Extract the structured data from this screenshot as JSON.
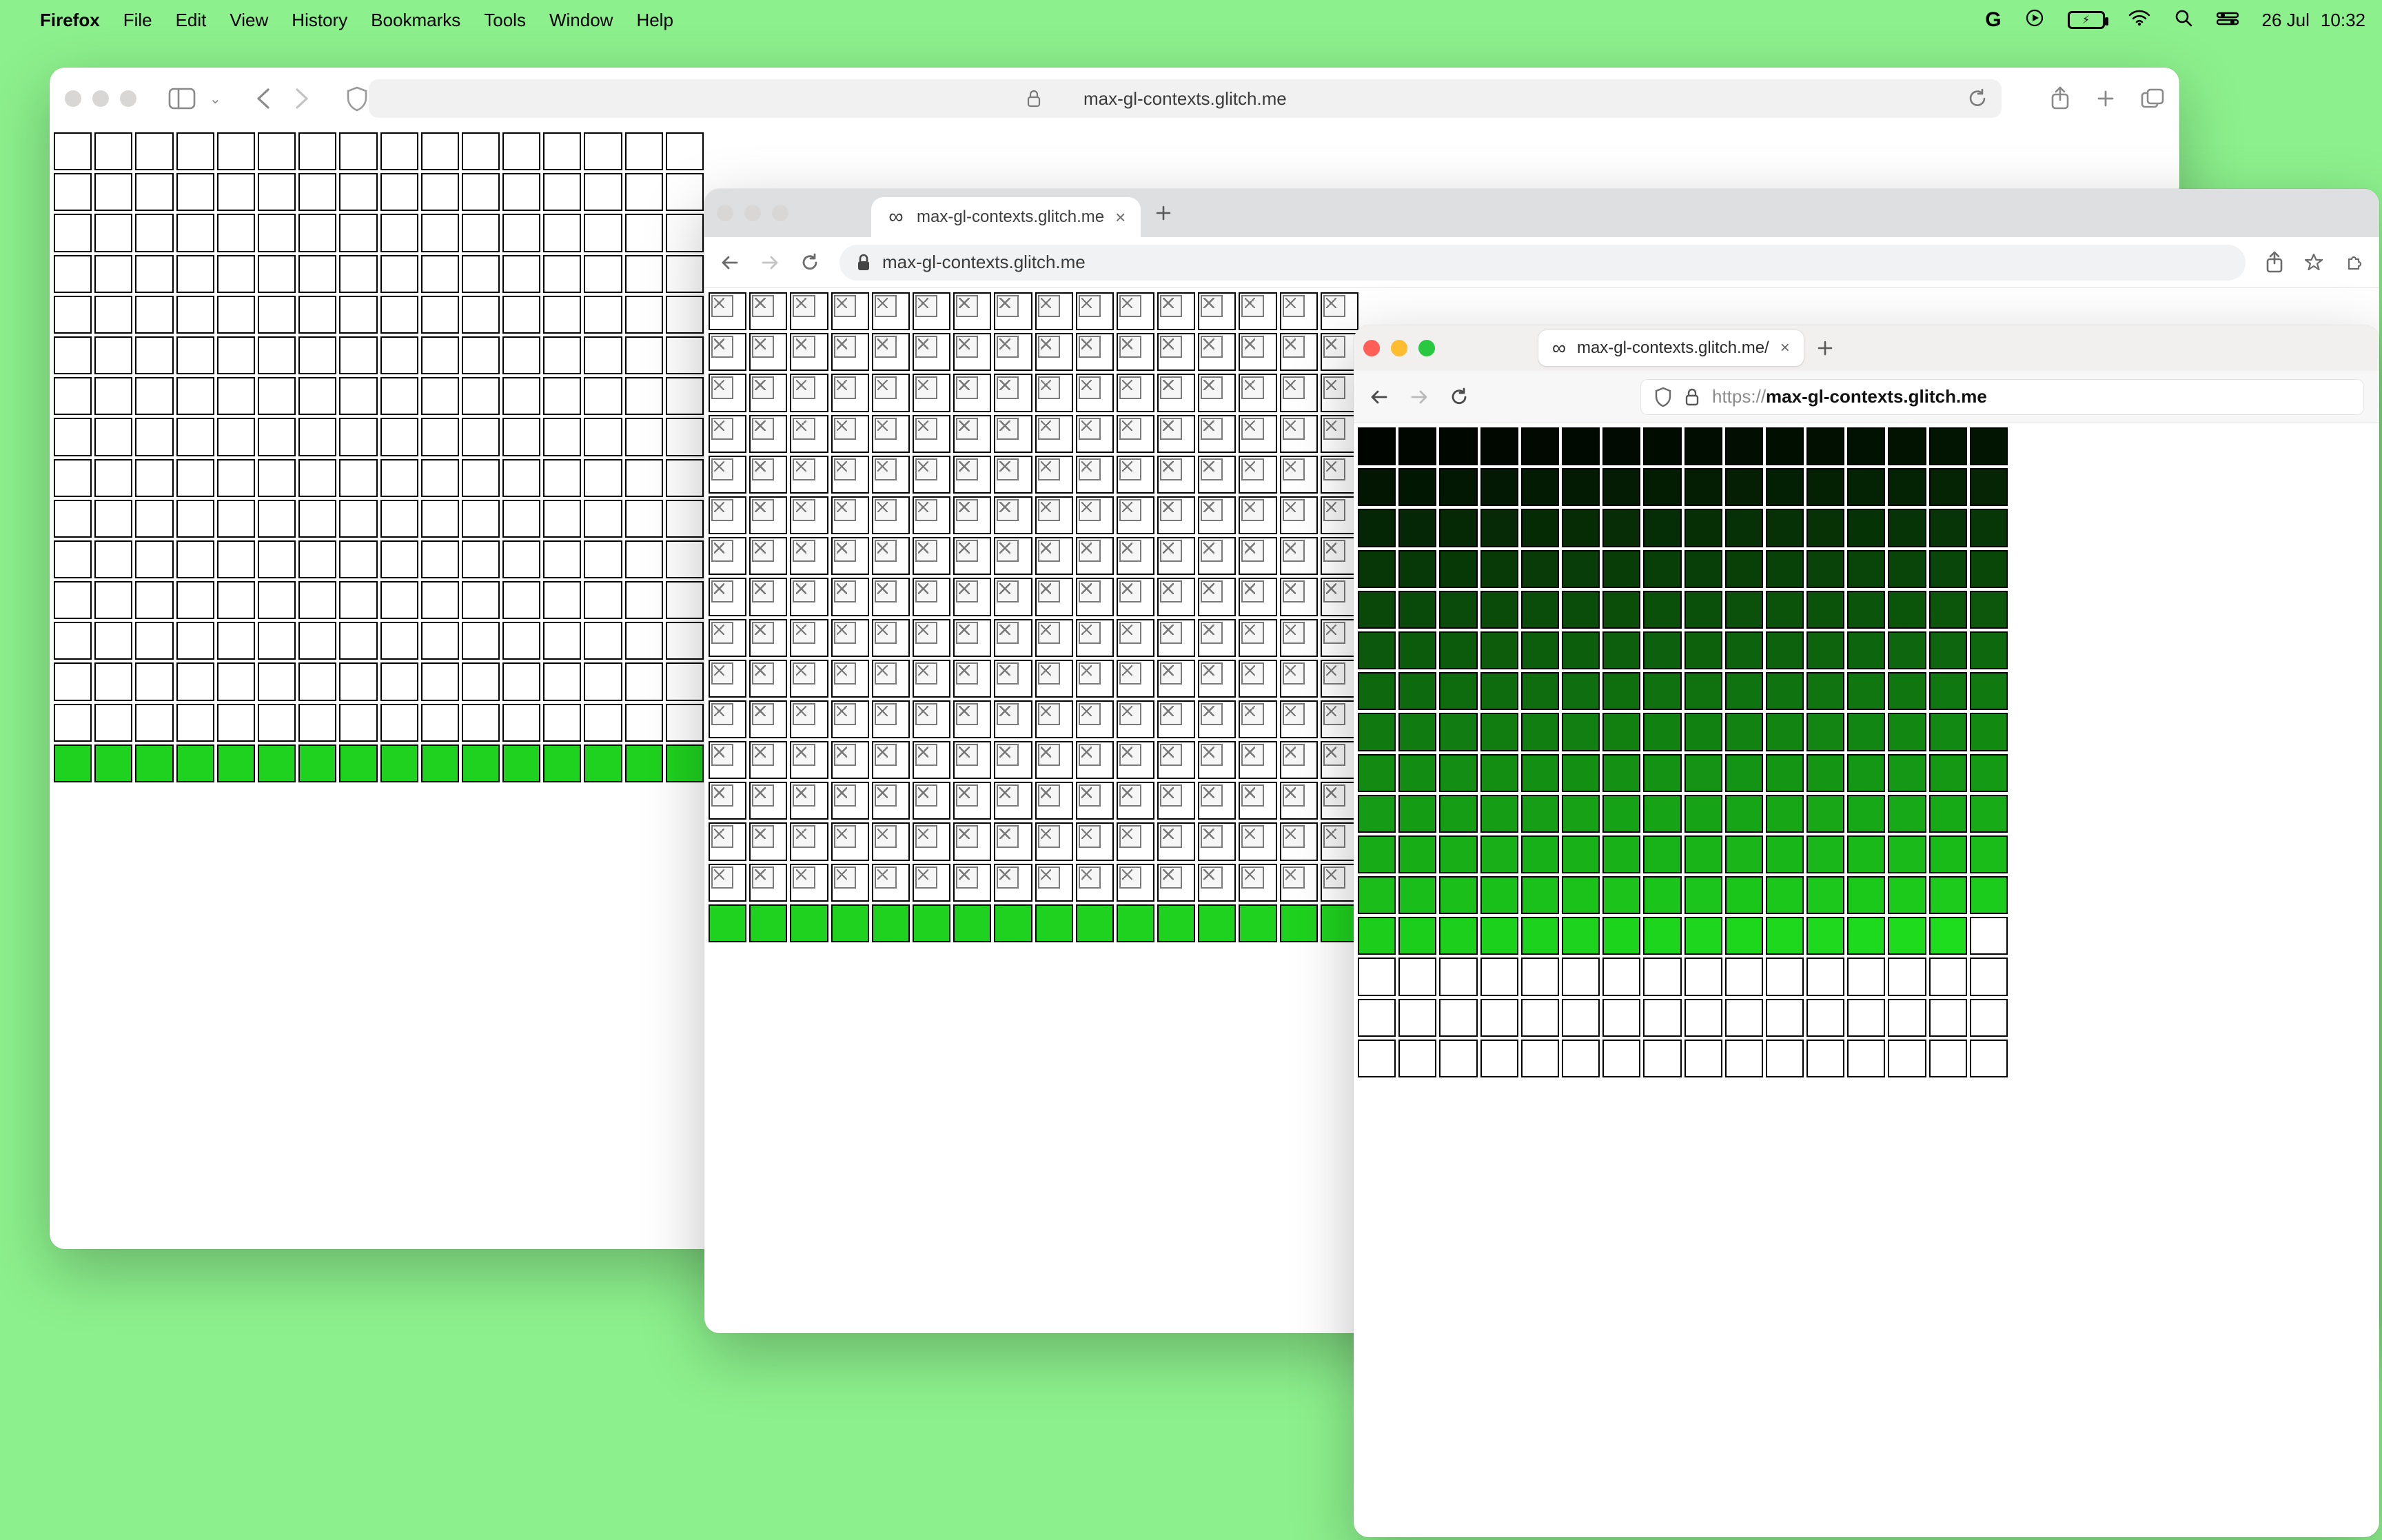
{
  "menubar": {
    "app": "Firefox",
    "items": [
      "File",
      "Edit",
      "View",
      "History",
      "Bookmarks",
      "Tools",
      "Window",
      "Help"
    ],
    "battery_glyph": "⚡︎",
    "date": "26 Jul",
    "time": "10:32"
  },
  "safari": {
    "url_display": "max-gl-contexts.glitch.me",
    "grid": {
      "cols": 16,
      "rows": 16,
      "green_row": 15
    }
  },
  "chrome": {
    "tab_title": "max-gl-contexts.glitch.me",
    "omnibox": "max-gl-contexts.glitch.me",
    "grid": {
      "cols": 16,
      "rows": 16,
      "green_row": 15
    }
  },
  "firefox": {
    "tab_title": "max-gl-contexts.glitch.me/",
    "url_prefix": "https://",
    "url_host": "max-gl-contexts.glitch.me",
    "grid": {
      "cols": 16,
      "rows": 16,
      "filled": 207
    }
  }
}
